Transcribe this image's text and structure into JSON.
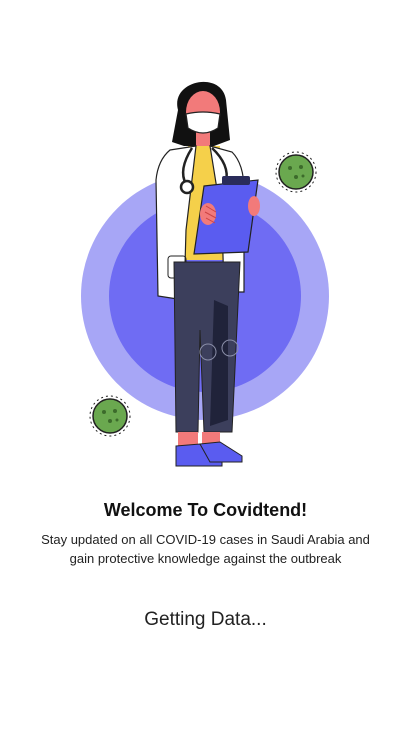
{
  "welcome": {
    "title": "Welcome To Covidtend!",
    "subtitle": "Stay updated on all COVID-19 cases in Saudi Arabia and gain protective knowledge against the outbreak"
  },
  "status": {
    "loading_text": "Getting Data..."
  },
  "illustration": {
    "icons": [
      "doctor-illustration",
      "virus-icon",
      "virus-icon"
    ],
    "colors": {
      "outer_circle": "#a7a6f6",
      "inner_circle": "#6f6cf3",
      "virus": "#6aa84f",
      "clipboard": "#5a5cf0",
      "skin": "#f27a7a",
      "hair": "#111111",
      "coat": "#ffffff",
      "pants": "#3c3f5c",
      "shirt": "#f5d04a",
      "shoes": "#5a5cf0"
    }
  }
}
